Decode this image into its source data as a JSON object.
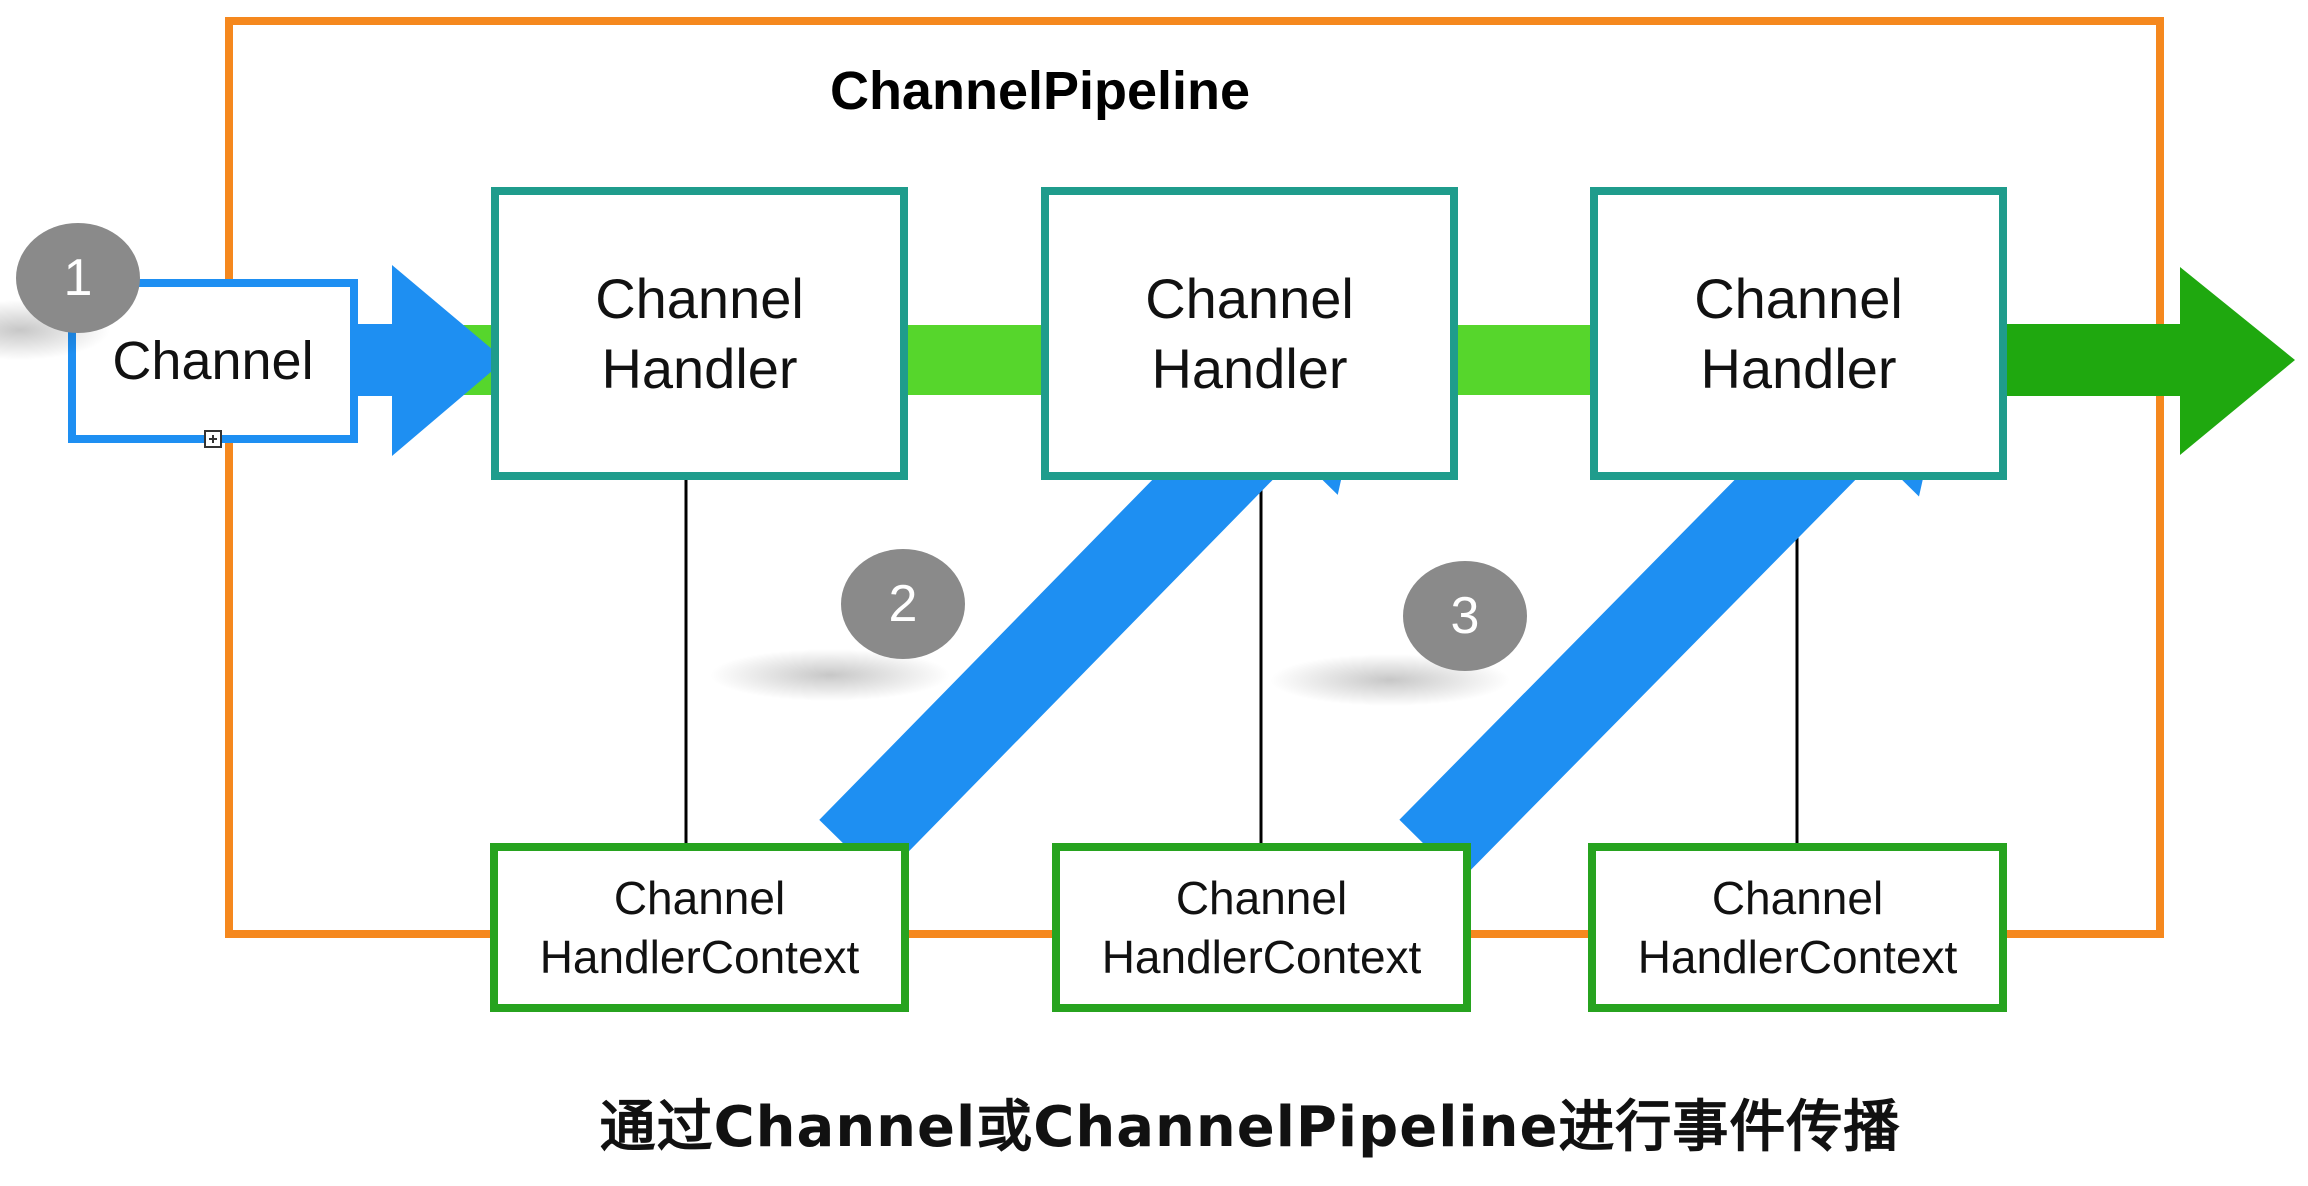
{
  "pipeline": {
    "title": "ChannelPipeline"
  },
  "channel": {
    "label": "Channel"
  },
  "handlers": [
    {
      "line1": "Channel",
      "line2": "Handler"
    },
    {
      "line1": "Channel",
      "line2": "Handler"
    },
    {
      "line1": "Channel",
      "line2": "Handler"
    }
  ],
  "contexts": [
    {
      "line1": "Channel",
      "line2": "HandlerContext"
    },
    {
      "line1": "Channel",
      "line2": "HandlerContext"
    },
    {
      "line1": "Channel",
      "line2": "HandlerContext"
    }
  ],
  "steps": [
    "1",
    "2",
    "3"
  ],
  "caption": "通过Channel或ChannelPipeline进行事件传播",
  "colors": {
    "pipeline_border": "#F5881E",
    "channel_border": "#1E8FF2",
    "handler_border": "#1F9C8C",
    "context_border": "#27A31F",
    "blue_arrow": "#1E8FF2",
    "green_bar": "#56D62C",
    "green_arrow": "#1FA80F",
    "badge": "#8A8A8A"
  }
}
